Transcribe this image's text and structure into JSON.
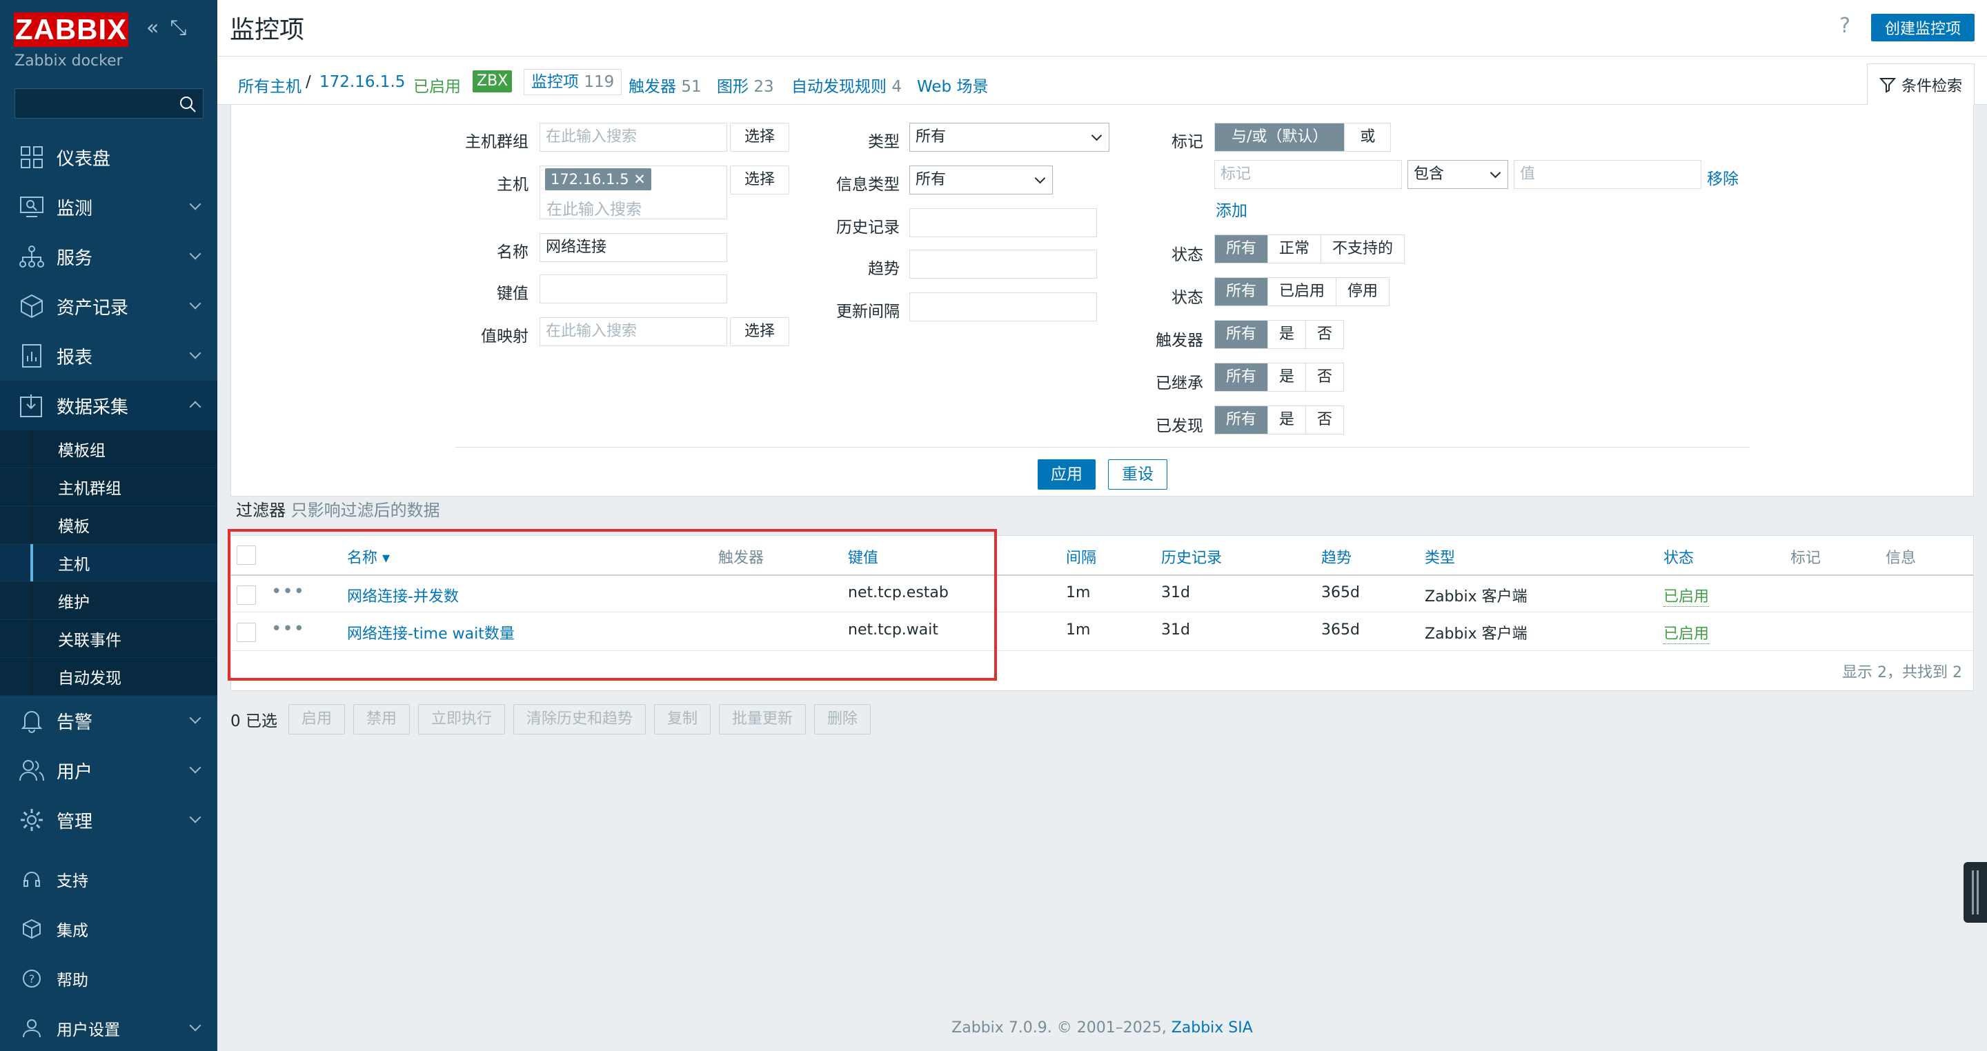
{
  "sidebar": {
    "logo": "ZABBIX",
    "subtitle": "Zabbix docker",
    "search_placeholder": "",
    "items": [
      {
        "label": "仪表盘",
        "icon": "dashboard-icon"
      },
      {
        "label": "监测",
        "icon": "monitoring-icon"
      },
      {
        "label": "服务",
        "icon": "services-icon"
      },
      {
        "label": "资产记录",
        "icon": "inventory-icon"
      },
      {
        "label": "报表",
        "icon": "reports-icon"
      },
      {
        "label": "数据采集",
        "icon": "data-collection-icon"
      }
    ],
    "subitems": [
      "模板组",
      "主机群组",
      "模板",
      "主机",
      "维护",
      "关联事件",
      "自动发现"
    ],
    "items2": [
      {
        "label": "告警",
        "icon": "bell-icon"
      },
      {
        "label": "用户",
        "icon": "users-icon"
      },
      {
        "label": "管理",
        "icon": "gear-icon"
      }
    ],
    "bottom": [
      "支持",
      "集成",
      "帮助",
      "用户设置"
    ]
  },
  "header": {
    "title": "监控项",
    "help": "?",
    "create_label": "创建监控项"
  },
  "nav": {
    "all_hosts": "所有主机",
    "sep": "/",
    "host": "172.16.1.5",
    "enabled": "已启用",
    "zbx": "ZBX",
    "items_label": "监控项",
    "items_count": "119",
    "triggers_label": "触发器",
    "triggers_count": "51",
    "graphs_label": "图形",
    "graphs_count": "23",
    "discovery_label": "自动发现规则",
    "discovery_count": "4",
    "web_label": "Web 场景",
    "filter_tab": "条件检索"
  },
  "filter": {
    "host_groups_label": "主机群组",
    "host_groups_ph": "在此输入搜索",
    "select": "选择",
    "hosts_label": "主机",
    "host_chip": "172.16.1.5",
    "hosts_ph": "在此输入搜索",
    "name_label": "名称",
    "name_value": "网络连接",
    "key_label": "键值",
    "key_value": "",
    "valuemap_label": "值映射",
    "valuemap_ph": "在此输入搜索",
    "type_label": "类型",
    "type_value": "所有",
    "info_type_label": "信息类型",
    "info_type_value": "所有",
    "history_label": "历史记录",
    "trends_label": "趋势",
    "interval_label": "更新间隔",
    "tags_label": "标记",
    "tags_and": "与/或（默认）",
    "tags_or": "或",
    "tag_ph": "标记",
    "tag_op": "包含",
    "value_ph": "值",
    "remove": "移除",
    "add": "添加",
    "state_label": "状态",
    "state_opts": [
      "所有",
      "正常",
      "不支持的"
    ],
    "status_label": "状态",
    "status_opts": [
      "所有",
      "已启用",
      "停用"
    ],
    "triggers_label": "触发器",
    "inherited_label": "已继承",
    "discovered_label": "已发现",
    "yn_opts": [
      "所有",
      "是",
      "否"
    ],
    "apply": "应用",
    "reset": "重设",
    "note_main": "过滤器",
    "note_sub": "只影响过滤后的数据"
  },
  "table": {
    "headers": {
      "name": "名称 ▾",
      "triggers": "触发器",
      "key": "键值",
      "interval": "间隔",
      "history": "历史记录",
      "trends": "趋势",
      "type": "类型",
      "status": "状态",
      "tags": "标记",
      "info": "信息"
    },
    "rows": [
      {
        "name": "网络连接-并发数",
        "key": "net.tcp.estab",
        "interval": "1m",
        "history": "31d",
        "trends": "365d",
        "type": "Zabbix 客户端",
        "status": "已启用"
      },
      {
        "name": "网络连接-time wait数量",
        "key": "net.tcp.wait",
        "interval": "1m",
        "history": "31d",
        "trends": "365d",
        "type": "Zabbix 客户端",
        "status": "已启用"
      }
    ],
    "paging": "显示 2，共找到 2"
  },
  "actions": {
    "selected": "0 已选",
    "buttons": [
      "启用",
      "禁用",
      "立即执行",
      "清除历史和趋势",
      "复制",
      "批量更新",
      "删除"
    ]
  },
  "footer": {
    "text": "Zabbix 7.0.9. © 2001–2025, ",
    "link": "Zabbix SIA"
  },
  "colors": {
    "sidebar": "#0e3f5f",
    "accent": "#0275b8",
    "ok": "#429e47",
    "logo": "#d40000"
  }
}
